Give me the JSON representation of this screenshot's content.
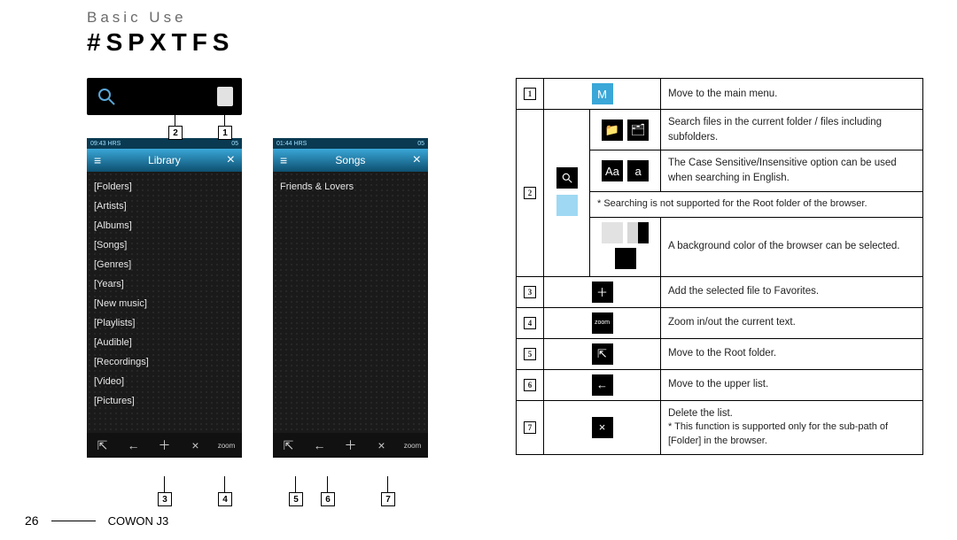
{
  "header": {
    "section": "Basic Use",
    "title": "#SPXTFS"
  },
  "footer": {
    "page": "26",
    "product": "COWON J3"
  },
  "device1": {
    "title": "Library",
    "status_left": "09:43 HRS",
    "status_right": "05",
    "items": [
      "[Folders]",
      "[Artists]",
      "[Albums]",
      "[Songs]",
      "[Genres]",
      "[Years]",
      "[New music]",
      "[Playlists]",
      "[Audible]",
      "[Recordings]",
      "[Video]",
      "[Pictures]"
    ]
  },
  "device2": {
    "title": "Songs",
    "status_left": "01:44 HRS",
    "status_right": "05",
    "items": [
      "Friends & Lovers"
    ]
  },
  "table": {
    "r1": {
      "desc": "Move to the main menu."
    },
    "r2a": {
      "desc": "Search files in the current folder / files including subfolders."
    },
    "r2b": {
      "desc": "The Case Sensitive/Insensitive option can be used when searching in English."
    },
    "r2note": "* Searching is not supported for the Root folder of the browser.",
    "r2c": {
      "desc": "A background color of the browser can be selected."
    },
    "r3": {
      "desc": "Add the selected file to Favorites."
    },
    "r4": {
      "desc": "Zoom in/out the current text."
    },
    "r5": {
      "desc": "Move to the Root folder."
    },
    "r6": {
      "desc": "Move to the upper list."
    },
    "r7": {
      "desc": "Delete the list.",
      "note": "* This function is supported only for the sub-path of [Folder] in the browser."
    }
  },
  "callouts": {
    "c1": "1",
    "c2": "2",
    "c3": "3",
    "c4": "4",
    "c5": "5",
    "c6": "6",
    "c7": "7"
  },
  "icons": {
    "zoom_label": "zoom",
    "aa1": "Aa",
    "aa2": "a",
    "m": "M"
  }
}
